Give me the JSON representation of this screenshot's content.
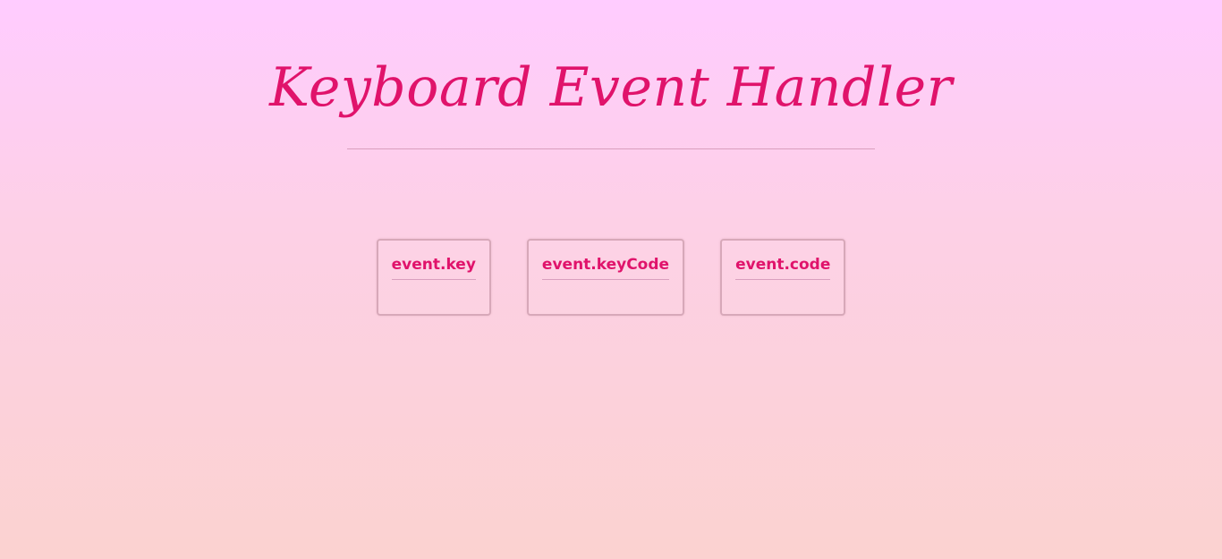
{
  "page": {
    "title": "Keyboard Event Handler"
  },
  "cards": [
    {
      "heading": "event.key",
      "value": ""
    },
    {
      "heading": "event.keyCode",
      "value": ""
    },
    {
      "heading": "event.code",
      "value": ""
    }
  ],
  "colors": {
    "accent": "#e0136b",
    "background_top": "#ffccff",
    "background_bottom": "#fbd2d0",
    "border": "#d7a8b9"
  }
}
